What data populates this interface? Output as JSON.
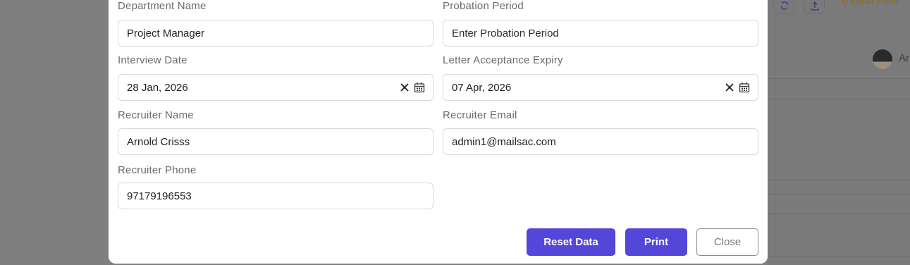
{
  "background": {
    "status_text": "Letter Pend",
    "avatar_text": "Ar",
    "icons": [
      "refresh-icon",
      "upload-icon"
    ]
  },
  "form": {
    "department_name": {
      "label": "Department Name",
      "value": "Project Manager"
    },
    "probation_period": {
      "label": "Probation Period",
      "placeholder": "Enter Probation Period"
    },
    "interview_date": {
      "label": "Interview Date",
      "value": "28 Jan, 2026"
    },
    "letter_acceptance_expiry": {
      "label": "Letter Acceptance Expiry",
      "value": "07 Apr, 2026"
    },
    "recruiter_name": {
      "label": "Recruiter Name",
      "value": "Arnold Crisss"
    },
    "recruiter_email": {
      "label": "Recruiter Email",
      "value": "admin1@mailsac.com"
    },
    "recruiter_phone": {
      "label": "Recruiter Phone",
      "value": "97179196553"
    }
  },
  "actions": {
    "reset_label": "Reset Data",
    "print_label": "Print",
    "close_label": "Close"
  },
  "colors": {
    "primary": "#5346d8",
    "overlay": "#7f7f7f",
    "border": "#d9d9d9"
  }
}
